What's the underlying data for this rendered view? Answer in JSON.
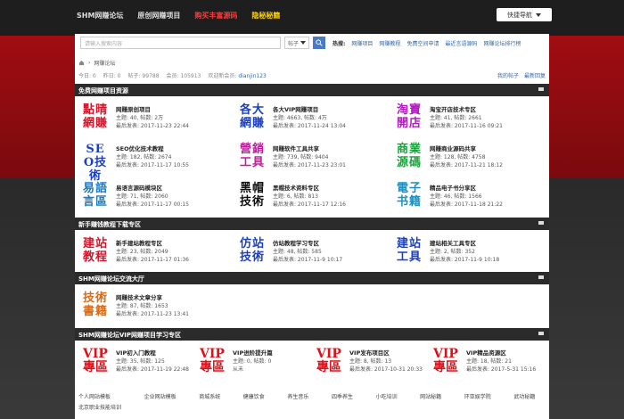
{
  "topbar": {
    "nav": [
      "SHM网赚论坛",
      "原创网赚项目",
      "购买丰富源码",
      "隐秘秘籍"
    ],
    "quick": "快捷导航"
  },
  "search": {
    "placeholder": "请输入搜索内容",
    "select": "帖子",
    "hot_label": "热搜:",
    "hot": [
      "网赚项目",
      "网赚教程",
      "免费空间申请",
      "最近言语源码",
      "网赚论坛排行榜"
    ]
  },
  "breadcrumb": [
    "网赚论坛"
  ],
  "stats": {
    "today": "今日: 0",
    "yesterday": "昨日: 0",
    "posts": "帖子: 99788",
    "members": "会员: 105913",
    "welcome": "欢迎新会员:",
    "newuser": "dianjin123",
    "mypost": "我的帖子",
    "newest": "最新回复"
  },
  "sections": [
    {
      "title": "免费网赚项目资源"
    },
    {
      "title": "新手赚钱教程下载专区"
    },
    {
      "title": "SHM网赚论坛交流大厅"
    },
    {
      "title": "SHM网赚论坛VIP网赚项目学习专区"
    }
  ],
  "forums1": [
    {
      "logo": "點晴網賺",
      "color": "#d4142a",
      "title": "网赚原创项目",
      "l1": "主题: 40, 帖数: 2万",
      "l2": "最后发表: 2017-11-23 22:44"
    },
    {
      "logo": "各大網賺",
      "color": "#1a3fc2",
      "title": "各大VIP网赚项目",
      "l1": "主题: 4663, 帖数: 4万",
      "l2": "最后发表: 2017-11-24 13:04"
    },
    {
      "logo": "淘寶開店",
      "color": "#b31ac2",
      "title": "淘宝开店技术专区",
      "l1": "主题: 41, 帖数: 2661",
      "l2": "最后发表: 2017-11-16 09:21"
    },
    {
      "logo": "SEO技術",
      "color": "#1a3fc2",
      "title": "SEO优化技术教程",
      "l1": "主题: 182, 帖数: 2674",
      "l2": "最后发表: 2017-11-17 10:55"
    },
    {
      "logo": "營銷工具",
      "color": "#c21a9e",
      "title": "网赚软件工具共享",
      "l1": "主题: 739, 帖数: 9404",
      "l2": "最后发表: 2017-11-23 23:01"
    },
    {
      "logo": "商業源碼",
      "color": "#1aa33a",
      "title": "网赚商业源码共享",
      "l1": "主题: 128, 帖数: 4758",
      "l2": "最后发表: 2017-11-21 18:12"
    },
    {
      "logo": "易語言區",
      "color": "#1a7ac2",
      "title": "易语言源码模块区",
      "l1": "主题: 71, 帖数: 2060",
      "l2": "最后发表: 2017-11-17 00:15"
    },
    {
      "logo": "黑帽技術",
      "color": "#111111",
      "title": "黑帽技术资料专区",
      "l1": "主题: 6, 帖数: 813",
      "l2": "最后发表: 2017-11-17 12:16"
    },
    {
      "logo": "電子书籍",
      "color": "#1a8fc2",
      "title": "精品电子书分享区",
      "l1": "主题: 46, 帖数: 1566",
      "l2": "最后发表: 2017-11-18 21:22"
    }
  ],
  "forums2": [
    {
      "logo": "建站教程",
      "color": "#d4142a",
      "title": "新手建站教程专区",
      "l1": "主题: 23, 帖数: 2049",
      "l2": "最后发表: 2017-11-17 01:36"
    },
    {
      "logo": "仿站技術",
      "color": "#1a3fc2",
      "title": "仿站教程学习专区",
      "l1": "主题: 48, 帖数: 585",
      "l2": "最后发表: 2017-11-9 10:17"
    },
    {
      "logo": "建站工具",
      "color": "#1a3fc2",
      "title": "建站相关工具专区",
      "l1": "主题: 2, 帖数: 352",
      "l2": "最后发表: 2017-11-9 10:18"
    }
  ],
  "forums3": [
    {
      "logo": "技術書籍",
      "color": "#e06a10",
      "title": "网赚技术文章分享",
      "l1": "主题: 87, 帖数: 1653",
      "l2": "最后发表: 2017-11-23 13:41"
    }
  ],
  "forums4": [
    {
      "logo": "VIP專區",
      "title": "VIP初入门教程",
      "l1": "主题: 35, 帖数: 125",
      "l2": "最后发表: 2017-11-19 22:48"
    },
    {
      "logo": "VIP專區",
      "title": "VIP进阶提升篇",
      "l1": "主题: 0, 帖数: 0",
      "l2": "从未"
    },
    {
      "logo": "VIP專區",
      "title": "VIP发布项目区",
      "l1": "主题: 8, 帖数: 13",
      "l2": "最后发表: 2017-10-31 20:33"
    },
    {
      "logo": "VIP專區",
      "title": "VIP精品资源区",
      "l1": "主题: 18, 帖数: 21",
      "l2": "最后发表: 2017-5-31 15:16"
    }
  ],
  "footer": [
    "个人网站模板",
    "企业网站模板",
    "商城系统",
    "健康饮食",
    "养生音乐",
    "四季养生",
    "小吃培训",
    "网站秘籍",
    "环亚娱学院",
    "武功秘籍",
    "北京职业技能培训"
  ]
}
